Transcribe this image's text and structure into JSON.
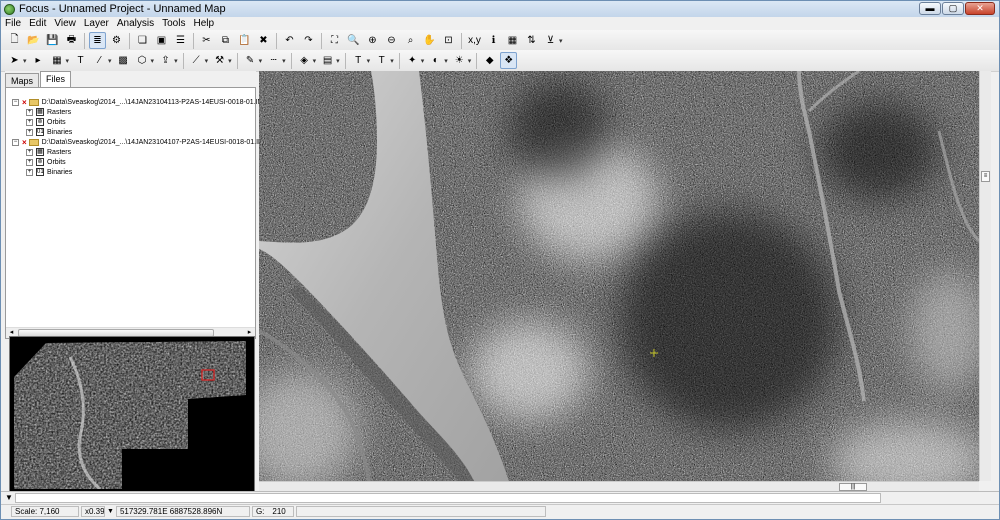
{
  "window": {
    "title": "Focus - Unnamed Project - Unnamed Map"
  },
  "menu": [
    "File",
    "Edit",
    "View",
    "Layer",
    "Analysis",
    "Tools",
    "Help"
  ],
  "toolbar1": [
    {
      "name": "new-icon",
      "glyph": "🗋"
    },
    {
      "name": "open-icon",
      "glyph": "📂"
    },
    {
      "name": "save-icon",
      "glyph": "💾"
    },
    {
      "name": "print-icon",
      "glyph": "🖶"
    },
    {
      "sep": true
    },
    {
      "name": "report-icon",
      "glyph": "≣",
      "active": true
    },
    {
      "name": "layers-view-icon",
      "glyph": "⚙"
    },
    {
      "sep": true
    },
    {
      "name": "properties-icon",
      "glyph": "❏"
    },
    {
      "name": "window-icon",
      "glyph": "▣"
    },
    {
      "name": "stack-icon",
      "glyph": "☰"
    },
    {
      "sep": true
    },
    {
      "name": "cut-icon",
      "glyph": "✂"
    },
    {
      "name": "copy-icon",
      "glyph": "⧉"
    },
    {
      "name": "paste-icon",
      "glyph": "📋"
    },
    {
      "name": "delete-icon",
      "glyph": "✖"
    },
    {
      "sep": true
    },
    {
      "name": "undo-icon",
      "glyph": "↶"
    },
    {
      "name": "redo-icon",
      "glyph": "↷"
    },
    {
      "sep": true
    },
    {
      "name": "zoom-extent-icon",
      "glyph": "⛶"
    },
    {
      "name": "zoom-window-icon",
      "glyph": "🔍"
    },
    {
      "name": "zoom-in-icon",
      "glyph": "⊕"
    },
    {
      "name": "zoom-out-icon",
      "glyph": "⊖"
    },
    {
      "name": "zoom-box-icon",
      "glyph": "⌕"
    },
    {
      "name": "pan-icon",
      "glyph": "✋"
    },
    {
      "name": "zoom-layer-icon",
      "glyph": "⊡"
    },
    {
      "sep": true
    },
    {
      "name": "coordinates-icon",
      "glyph": "x,y"
    },
    {
      "name": "info-icon",
      "glyph": "ℹ"
    },
    {
      "name": "table-icon",
      "glyph": "▦"
    },
    {
      "name": "sort-icon",
      "glyph": "⇅"
    },
    {
      "name": "filter-icon",
      "glyph": "⊻",
      "dropdown": true
    }
  ],
  "toolbar2": [
    {
      "name": "select-arrow-icon",
      "glyph": "➤",
      "dropdown": true
    },
    {
      "name": "node-select-icon",
      "glyph": "▸"
    },
    {
      "name": "grid-select-icon",
      "glyph": "▦",
      "dropdown": true
    },
    {
      "name": "text-tool-icon",
      "glyph": "T"
    },
    {
      "name": "line-style-icon",
      "glyph": "⁄",
      "dropdown": true
    },
    {
      "name": "raster-grid-icon",
      "glyph": "▩"
    },
    {
      "name": "polygon-edit-icon",
      "glyph": "⬡",
      "dropdown": true
    },
    {
      "name": "export-icon",
      "glyph": "⇪",
      "dropdown": true
    },
    {
      "sep": true
    },
    {
      "name": "draw-line-icon",
      "glyph": "⟋",
      "dropdown": true
    },
    {
      "name": "tools-icon",
      "glyph": "⚒",
      "dropdown": true
    },
    {
      "sep": true
    },
    {
      "name": "line-color-icon",
      "glyph": "✎",
      "dropdown": true
    },
    {
      "name": "line-width-icon",
      "glyph": "┄",
      "dropdown": true
    },
    {
      "sep": true
    },
    {
      "name": "fill-color-icon",
      "glyph": "◈",
      "dropdown": true
    },
    {
      "name": "fill-pattern-icon",
      "glyph": "▤",
      "dropdown": true
    },
    {
      "sep": true
    },
    {
      "name": "font-color-icon",
      "glyph": "T",
      "dropdown": true
    },
    {
      "name": "font-size-icon",
      "glyph": "T",
      "dropdown": true
    },
    {
      "sep": true
    },
    {
      "name": "symbol-icon",
      "glyph": "✦",
      "dropdown": true
    },
    {
      "name": "opacity-icon",
      "glyph": "◐",
      "dropdown": true
    },
    {
      "name": "enhance-icon",
      "glyph": "☀",
      "dropdown": true
    },
    {
      "sep": true
    },
    {
      "name": "layer-stack-icon",
      "glyph": "◆"
    },
    {
      "name": "layer-manage-icon",
      "glyph": "❖",
      "active": true
    }
  ],
  "left_panel": {
    "tabs": [
      "Maps",
      "Files"
    ],
    "selected_tab": "Files",
    "files": [
      {
        "path": "D:\\Data\\Sveaskog\\2014_...\\14JAN23104113-P2AS-14EUSI-0018-01.IMD",
        "children": [
          "Rasters",
          "Orbits",
          "Binaries"
        ]
      },
      {
        "path": "D:\\Data\\Sveaskog\\2014_...\\14JAN23104107-P2AS-14EUSI-0018-01.IMD",
        "children": [
          "Rasters",
          "Orbits",
          "Binaries"
        ]
      }
    ]
  },
  "status": {
    "scale": "Scale: 7,160",
    "zoom": "x0.39",
    "coordinates": "517329.781E 6887528.896N",
    "pixel_value_label": "G:",
    "pixel_value": "210"
  },
  "window_controls": {
    "minimize": "▬",
    "maximize": "▢",
    "close": "✕"
  }
}
